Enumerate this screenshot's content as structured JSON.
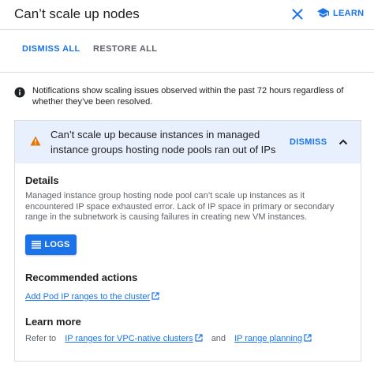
{
  "header": {
    "title": "Can’t scale up nodes",
    "learn_label": "LEARN"
  },
  "actions": {
    "dismiss_all": "DISMISS ALL",
    "restore_all": "RESTORE ALL"
  },
  "info": {
    "text": "Notifications show scaling issues observed within the past 72 hours regardless of whether they’ve been resolved."
  },
  "notification": {
    "title": "Can’t scale up because instances in managed instance groups hosting node pools ran out of IPs",
    "dismiss_label": "DISMISS",
    "details_heading": "Details",
    "details_text": "Managed instance group hosting node pool can’t scale up instances as it encountered IP space exhausted error. Lack of IP space in primary or secondary range in the subnetwork is causing failures in creating new VM instances.",
    "logs_label": "LOGS",
    "recommended_heading": "Recommended actions",
    "recommended_link": "Add Pod IP ranges to the cluster",
    "learn_more_heading": "Learn more",
    "refer_prefix": "Refer to",
    "refer_link_1": "IP ranges for VPC-native clusters",
    "refer_and": "and",
    "refer_link_2": "IP range planning"
  },
  "colors": {
    "accent": "#1a73e8",
    "warning": "#e37400",
    "card_header_bg": "#e8f0fe"
  },
  "icons": [
    "close-icon",
    "school-icon",
    "info-icon",
    "warning-icon",
    "chevron-up-icon",
    "list-icon",
    "external-link-icon"
  ]
}
